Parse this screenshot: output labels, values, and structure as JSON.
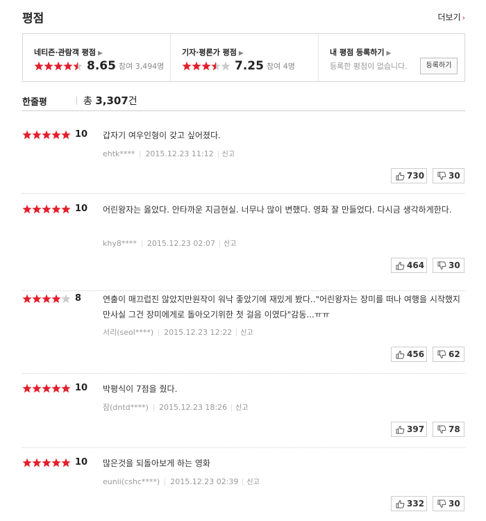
{
  "header": {
    "title": "평점",
    "more_label": "더보기"
  },
  "summary": {
    "netizen": {
      "label": "네티즌·관람객 평점",
      "score": "8.65",
      "count": "참여 3,494명",
      "stars": 4.5
    },
    "critic": {
      "label": "기자·평론가 평점",
      "score": "7.25",
      "count": "참여 4명",
      "stars": 3.5
    },
    "mine": {
      "label": "내 평점 등록하기",
      "note": "등록한 평점이 없습니다.",
      "button": "등록하기"
    }
  },
  "one_liner": {
    "label": "한줄평",
    "prefix": "총",
    "count": "3,307",
    "suffix": "건"
  },
  "colors": {
    "accent": "#e31f2c",
    "star_off": "#cccccc"
  },
  "reviews": [
    {
      "stars": 5,
      "score": "10",
      "text": "갑자기 여우인형이 갖고 싶어졌다.",
      "user": "ehtk****",
      "date": "2015.12.23 11:12",
      "report": "신고",
      "up": "730",
      "down": "30"
    },
    {
      "stars": 5,
      "score": "10",
      "text": "어린왕자는 옳았다. 안타까운 지금현실. 너무나 많이 변했다. 영화 잘 만들었다. 다시금 생각하게한다.",
      "user": "khy8****",
      "date": "2015.12.23 02:07",
      "report": "신고",
      "up": "464",
      "down": "30"
    },
    {
      "stars": 4,
      "score": "8",
      "text": "연출이 매끄럽진 않았지만원작이 워낙 좋았기에 재밌게 봤다..\"어린왕자는 장미를 떠나 여행을 시작했지만사실 그건 장미에게로 돌아오기위한 첫 걸음 이였다\"감동...ㅠㅠ",
      "user": "서리(seol****)",
      "date": "2015.12.23 12:22",
      "report": "신고",
      "up": "456",
      "down": "62"
    },
    {
      "stars": 5,
      "score": "10",
      "text": "박평식이 7점을 줬다.",
      "user": "잠(dntd****)",
      "date": "2015.12.23 18:26",
      "report": "신고",
      "up": "397",
      "down": "78"
    },
    {
      "stars": 5,
      "score": "10",
      "text": "많은것을 되돌아보게 하는 영화",
      "user": "eunii(cshc****)",
      "date": "2015.12.23 02:39",
      "report": "신고",
      "up": "332",
      "down": "30"
    }
  ]
}
